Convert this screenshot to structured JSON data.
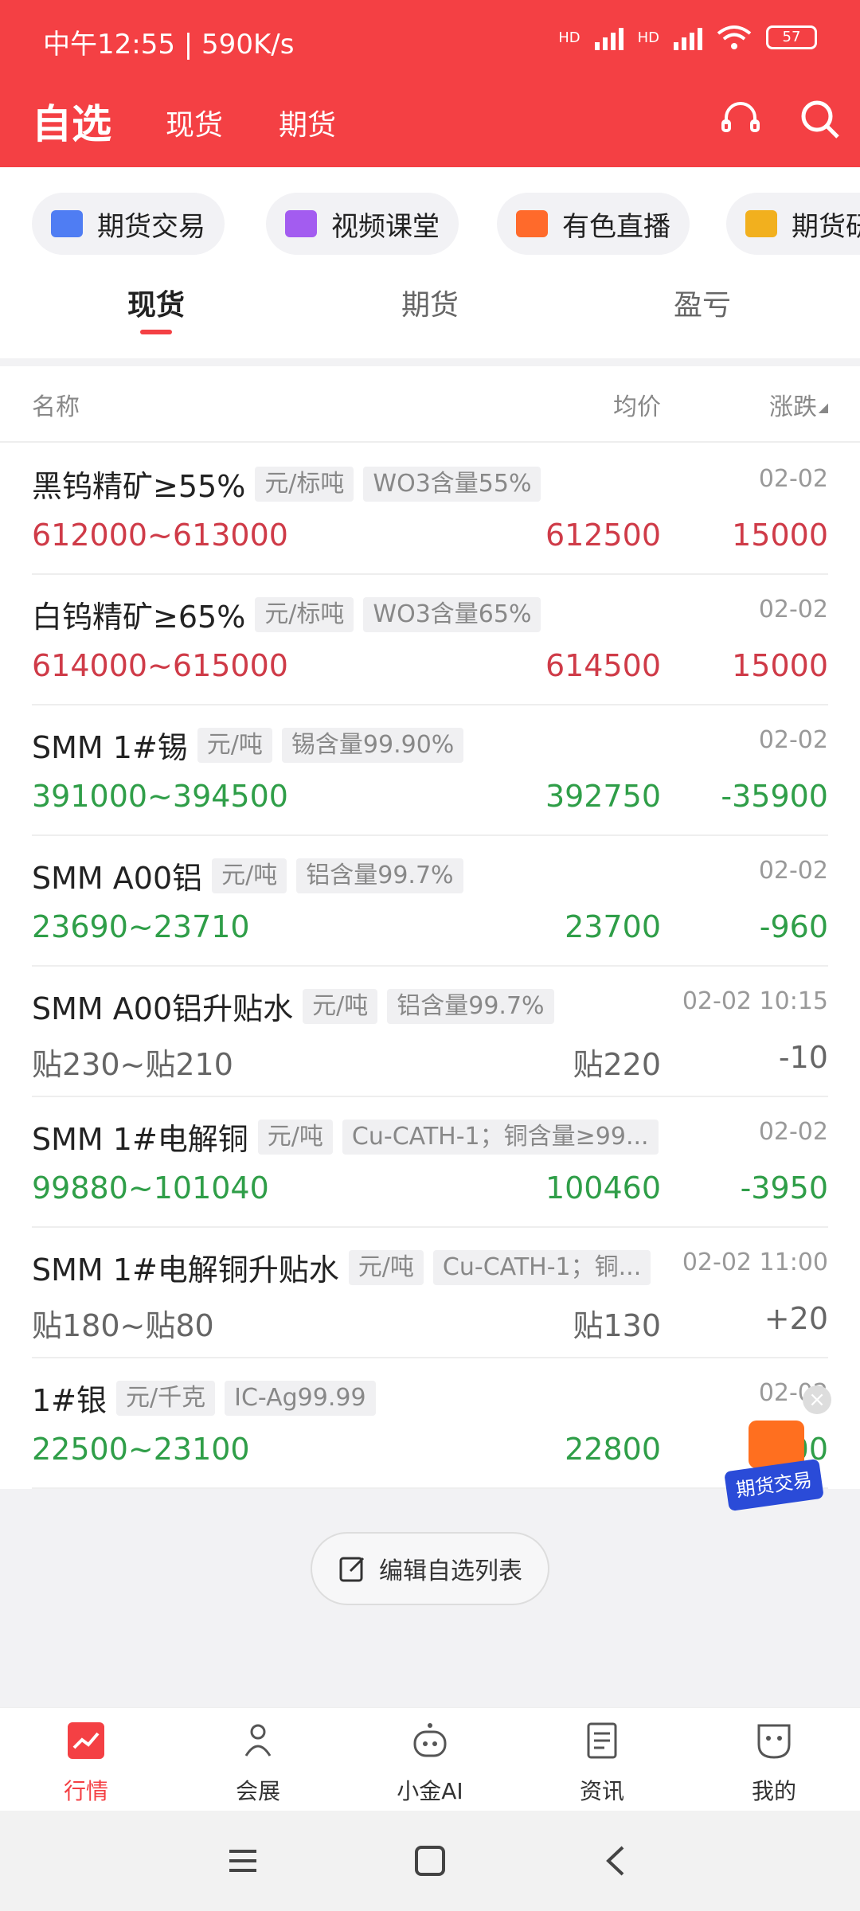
{
  "status_bar": {
    "time_speed": "中午12:55 | 590K/s",
    "battery": "57",
    "network": [
      "HD",
      "HD"
    ]
  },
  "header": {
    "title": "自选",
    "tabs": [
      "现货",
      "期货"
    ]
  },
  "chips": [
    {
      "label": "期货交易",
      "icon": "user-icon",
      "color": "#4f7df3"
    },
    {
      "label": "视频课堂",
      "icon": "video-icon",
      "color": "#a35cf0"
    },
    {
      "label": "有色直播",
      "icon": "live-icon",
      "color": "#ff6a2b"
    },
    {
      "label": "期货研",
      "icon": "doc-icon",
      "color": "#f2b01e"
    }
  ],
  "sub_tabs": [
    "现货",
    "期货",
    "盈亏"
  ],
  "columns": {
    "name": "名称",
    "avg": "均价",
    "change": "涨跌"
  },
  "rows": [
    {
      "name": "黑钨精矿≥55%",
      "unit": "元/标吨",
      "spec": "WO3含量55%",
      "date": "02-02",
      "range": "612000~613000",
      "avg": "612500",
      "change": "15000",
      "color": "red"
    },
    {
      "name": "白钨精矿≥65%",
      "unit": "元/标吨",
      "spec": "WO3含量65%",
      "date": "02-02",
      "range": "614000~615000",
      "avg": "614500",
      "change": "15000",
      "color": "red"
    },
    {
      "name": "SMM 1#锡",
      "unit": "元/吨",
      "spec": "锡含量99.90%",
      "date": "02-02",
      "range": "391000~394500",
      "avg": "392750",
      "change": "-35900",
      "color": "green"
    },
    {
      "name": "SMM A00铝",
      "unit": "元/吨",
      "spec": "铝含量99.7%",
      "date": "02-02",
      "range": "23690~23710",
      "avg": "23700",
      "change": "-960",
      "color": "green"
    },
    {
      "name": "SMM A00铝升贴水",
      "unit": "元/吨",
      "spec": "铝含量99.7%",
      "date": "02-02 10:15",
      "range": "贴230~贴210",
      "avg": "贴220",
      "change": "-10",
      "color": "gray"
    },
    {
      "name": "SMM 1#电解铜",
      "unit": "元/吨",
      "spec": "Cu-CATH-1；铜含量≥99...",
      "date": "02-02",
      "range": "99880~101040",
      "avg": "100460",
      "change": "-3950",
      "color": "green"
    },
    {
      "name": "SMM 1#电解铜升贴水",
      "unit": "元/吨",
      "spec": "Cu-CATH-1；铜...",
      "date": "02-02 11:00",
      "range": "贴180~贴80",
      "avg": "贴130",
      "change": "+20",
      "color": "gray"
    },
    {
      "name": "1#银",
      "unit": "元/千克",
      "spec": "IC-Ag99.99",
      "date": "02-02",
      "range": "22500~23100",
      "avg": "22800",
      "change": "-300",
      "color": "green"
    }
  ],
  "edit_button": "编辑自选列表",
  "float_badge": "期货交易",
  "bottom_nav": [
    {
      "label": "行情",
      "icon": "chart-icon"
    },
    {
      "label": "会展",
      "icon": "people-icon"
    },
    {
      "label": "小金AI",
      "icon": "robot-icon"
    },
    {
      "label": "资讯",
      "icon": "news-icon"
    },
    {
      "label": "我的",
      "icon": "profile-icon"
    }
  ]
}
